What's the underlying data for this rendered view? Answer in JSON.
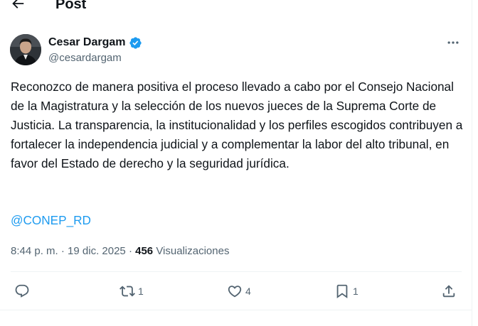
{
  "header": {
    "title": "Post"
  },
  "author": {
    "name": "Cesar Dargam",
    "handle": "@cesardargam"
  },
  "tweet": {
    "text": "Reconozco de manera positiva el proceso llevado a cabo por el Consejo Nacional de la Magistratura y la selección de los nuevos jueces de la Suprema Corte de Justicia. La transparencia, la institucionalidad y los perfiles escogidos contribuyen a fortalecer la independencia judicial y a complementar la labor del alto tribunal, en favor del Estado de derecho y la seguridad jurídica.",
    "mention": "@CONEP_RD",
    "time": "8:44 p. m.",
    "separator": "·",
    "date": "19 dic. 2025",
    "views_count": "456",
    "views_label": "Visualizaciones"
  },
  "actions": {
    "reply_count": "",
    "retweet_count": "1",
    "like_count": "4",
    "bookmark_count": "1"
  },
  "colors": {
    "accent": "#1d9bf0",
    "secondary_text": "#536471",
    "divider": "#eff3f4"
  },
  "icons": [
    "back-arrow-icon",
    "verified-badge-icon",
    "more-icon",
    "reply-icon",
    "retweet-icon",
    "like-icon",
    "bookmark-icon",
    "share-icon"
  ]
}
